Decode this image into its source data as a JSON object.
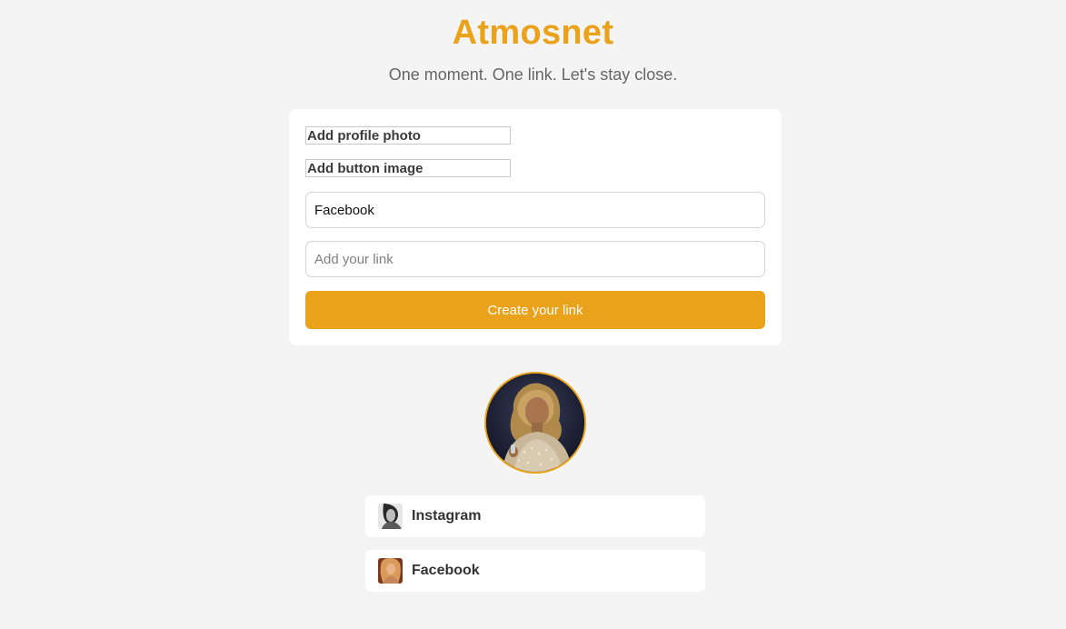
{
  "app": {
    "title": "Atmosnet",
    "tagline": "One moment. One link. Let's stay close."
  },
  "form": {
    "add_profile_photo_label": "Add profile photo",
    "add_button_image_label": "Add button image",
    "link_name_value": "Facebook",
    "link_url_placeholder": "Add your link",
    "create_button_label": "Create your link"
  },
  "preview": {
    "links": [
      {
        "label": "Instagram",
        "thumb_icon": "bw-portrait-thumbnail"
      },
      {
        "label": "Facebook",
        "thumb_icon": "warm-portrait-thumbnail"
      }
    ]
  },
  "colors": {
    "accent": "#e9a21a",
    "background": "#f4f4f4",
    "card": "#ffffff"
  }
}
